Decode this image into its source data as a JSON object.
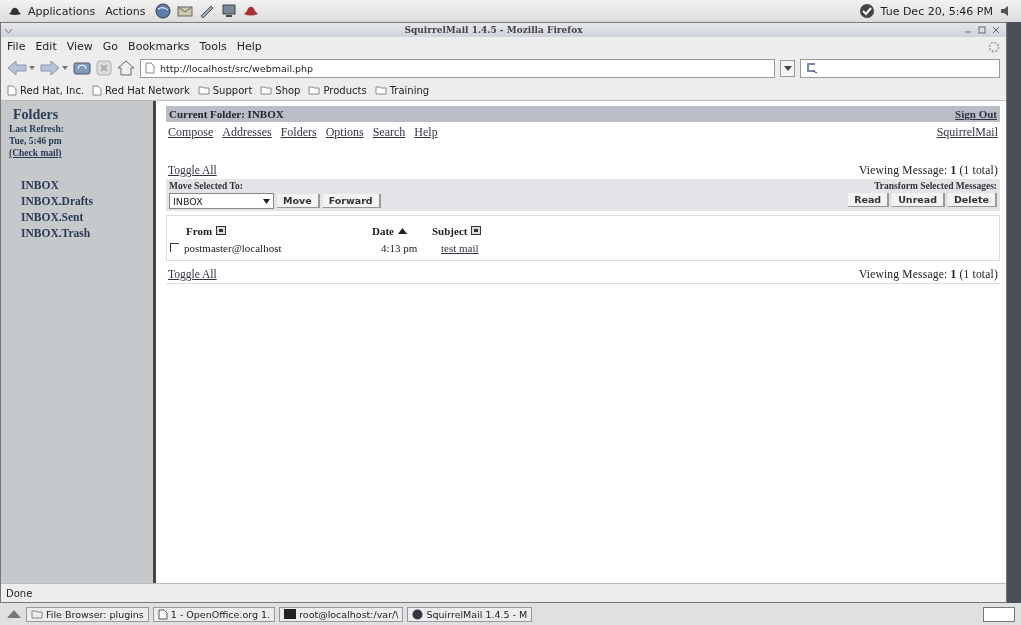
{
  "top_panel": {
    "menus": [
      "Applications",
      "Actions"
    ],
    "clock": "Tue Dec 20, 5:46 PM"
  },
  "window": {
    "title": "SquirrelMail 1.4.5 - Mozilla Firefox"
  },
  "menu_bar": [
    "File",
    "Edit",
    "View",
    "Go",
    "Bookmarks",
    "Tools",
    "Help"
  ],
  "address_bar": {
    "value": "http://localhost/src/webmail.php"
  },
  "bookmarks": [
    {
      "label": "Red Hat, Inc.",
      "kind": "page"
    },
    {
      "label": "Red Hat Network",
      "kind": "page"
    },
    {
      "label": "Support",
      "kind": "folder"
    },
    {
      "label": "Shop",
      "kind": "folder"
    },
    {
      "label": "Products",
      "kind": "folder"
    },
    {
      "label": "Training",
      "kind": "folder"
    }
  ],
  "sidebar": {
    "title": "Folders",
    "last_refresh_label": "Last Refresh:",
    "last_refresh_time": "Tue, 5:46 pm",
    "check_mail": "(Check mail)",
    "folders": [
      "INBOX",
      "INBOX.Drafts",
      "INBOX.Sent",
      "INBOX.Trash"
    ]
  },
  "header": {
    "current_folder_label": "Current Folder:",
    "current_folder": "INBOX",
    "sign_out": "Sign Out"
  },
  "nav_links": [
    "Compose",
    "Addresses",
    "Folders",
    "Options",
    "Search",
    "Help"
  ],
  "brand_link": "SquirrelMail",
  "toggle_all_top": "Toggle All",
  "viewing_top": "Viewing Message: **1** (1 total)",
  "move_label": "Move Selected To:",
  "move_select": "INBOX",
  "move_buttons": [
    "Move",
    "Forward"
  ],
  "transform_label": "Transform Selected Messages:",
  "transform_buttons": [
    "Read",
    "Unread",
    "Delete"
  ],
  "columns": [
    {
      "label": "From",
      "sorted": false
    },
    {
      "label": "Date",
      "sorted": true
    },
    {
      "label": "Subject",
      "sorted": false
    }
  ],
  "messages": [
    {
      "checked": false,
      "from": "postmaster@localhost",
      "date": "4:13 pm",
      "subject": "test mail"
    }
  ],
  "toggle_all_bottom": "Toggle All",
  "viewing_bottom": "Viewing Message: **1** (1 total)",
  "status_bar": "Done",
  "taskbar": [
    {
      "label": "File Browser: plugins",
      "kind": "folder"
    },
    {
      "label": "1 - OpenOffice.org 1.",
      "kind": "document"
    },
    {
      "label": "root@localhost:/var/\\",
      "kind": "terminal"
    },
    {
      "label": "SquirrelMail 1.4.5 - M",
      "kind": "browser"
    }
  ]
}
